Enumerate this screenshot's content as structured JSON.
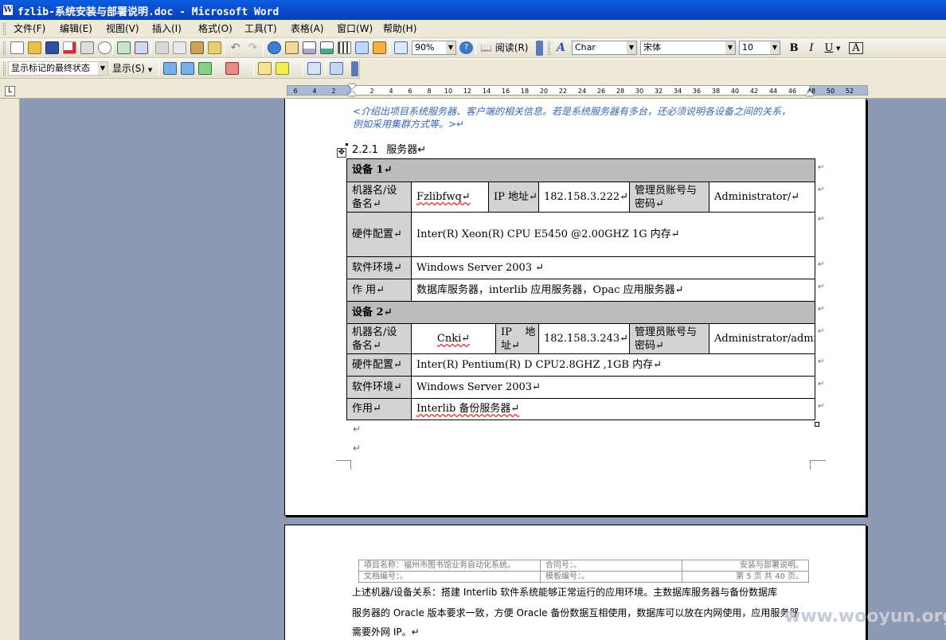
{
  "window": {
    "title": "fzlib-系统安装与部署说明.doc - Microsoft Word"
  },
  "menu": [
    "文件(F)",
    "编辑(E)",
    "视图(V)",
    "插入(I)",
    "格式(O)",
    "工具(T)",
    "表格(A)",
    "窗口(W)",
    "帮助(H)"
  ],
  "toolbar": {
    "zoom": "90%",
    "read_label": "阅读(R)",
    "style": "Char",
    "font": "宋体",
    "size": "10",
    "bold": "B",
    "italic": "I",
    "underline": "U",
    "char_border": "A"
  },
  "review_toolbar": {
    "markup_mode": "显示标记的最终状态",
    "show_label": "显示(S)"
  },
  "ruler": {
    "ticks": [
      "6",
      "4",
      "2",
      "2",
      "4",
      "6",
      "8",
      "10",
      "12",
      "14",
      "16",
      "18",
      "20",
      "22",
      "24",
      "26",
      "28",
      "30",
      "32",
      "34",
      "36",
      "38",
      "40",
      "42",
      "44",
      "46",
      "48",
      "50",
      "52",
      "54"
    ]
  },
  "document": {
    "intro_line1": "<介绍出项目系统服务器、客户端的相关信息。若是系统服务器有多台，还必须说明各设备之间的关系，",
    "intro_line2": "例如采用集群方式等。>↵",
    "heading_num": "2.2.1",
    "heading_text": "服务器↵",
    "device1": {
      "title": "设备 1↵",
      "name_label_1": "机器名/设",
      "name_label_2": "备名↵",
      "name_value": "Fzlibfwq↵",
      "ip_label": "IP 地址↵",
      "ip_value": "182.158.3.222↵",
      "admin_label_1": "管理员账号与",
      "admin_label_2": "密码↵",
      "admin_value": "Administrator/↵",
      "hw_label": "硬件配置↵",
      "hw_value": "Inter(R) Xeon(R) CPU E5450 @2.00GHZ      1G 内存↵",
      "sw_label": "软件环境↵",
      "sw_value": "Windows Server 2003 ↵",
      "use_label": "作  用↵",
      "use_value": "数据库服务器，interlib 应用服务器，Opac 应用服务器↵"
    },
    "device2": {
      "title": "设备 2↵",
      "name_label_1": "机器名/设",
      "name_label_2": "备名↵",
      "name_value": "Cnki↵",
      "ip_label_1": "IP    地",
      "ip_label_2": "址↵",
      "ip_value": "182.158.3.243↵",
      "admin_label_1": "管理员账号与",
      "admin_label_2": "密码↵",
      "admin_value": "Administrator/admin↵",
      "hw_label": "硬件配置↵",
      "hw_value": "Inter(R) Pentium(R) D CPU2.8GHZ  ,1GB 内存↵",
      "sw_label": "软件环境↵",
      "sw_value": "Windows Server 2003↵",
      "use_label": "作用↵",
      "use_value": "Interlib 备份服务器↵"
    },
    "empty_para": "↵",
    "page2_header": {
      "project": "项目名称：福州市图书馆业务自动化系统。",
      "contract": "合同号：。",
      "doc_title": "安装与部署说明。",
      "doc_no": "文档编号：。",
      "template_no": "模板编号：。",
      "page_info": "第 5 页 共 40 页。"
    },
    "page2_para": [
      "上述机器/设备关系：搭建 Interlib 软件系统能够正常运行的应用环境。主数据库服务器与备份数据库",
      "服务器的 Oracle 版本要求一致，方便 Oracle 备份数据互相使用，数据库可以放在内网使用，应用服务器",
      "需要外网 IP。↵"
    ]
  },
  "watermark": "www.wooyun.org"
}
